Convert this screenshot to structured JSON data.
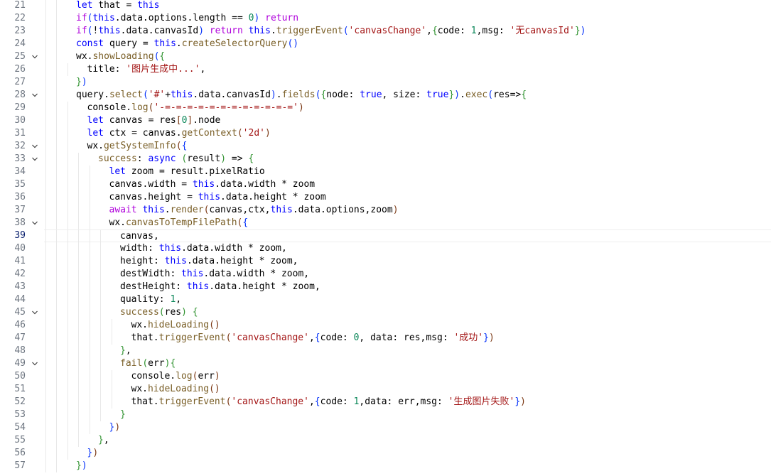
{
  "editor": {
    "current_line": 39,
    "lines": [
      {
        "n": "21",
        "i": 3,
        "t": [
          [
            "kw",
            "let"
          ],
          [
            "txt",
            " that = "
          ],
          [
            "this",
            "this"
          ]
        ]
      },
      {
        "n": "22",
        "i": 3,
        "t": [
          [
            "ctrl",
            "if"
          ],
          [
            "p1",
            "("
          ],
          [
            "this",
            "this"
          ],
          [
            "txt",
            ".data.options.length == "
          ],
          [
            "num",
            "0"
          ],
          [
            "p1",
            ")"
          ],
          [
            "txt",
            " "
          ],
          [
            "ctrl",
            "return"
          ]
        ]
      },
      {
        "n": "23",
        "i": 3,
        "t": [
          [
            "ctrl",
            "if"
          ],
          [
            "p1",
            "("
          ],
          [
            "txt",
            "!"
          ],
          [
            "this",
            "this"
          ],
          [
            "txt",
            ".data.canvasId"
          ],
          [
            "p1",
            ")"
          ],
          [
            "txt",
            " "
          ],
          [
            "ctrl",
            "return"
          ],
          [
            "txt",
            " "
          ],
          [
            "this",
            "this"
          ],
          [
            "txt",
            "."
          ],
          [
            "fn",
            "triggerEvent"
          ],
          [
            "p1",
            "("
          ],
          [
            "str",
            "'canvasChange'"
          ],
          [
            "txt",
            ","
          ],
          [
            "p2",
            "{"
          ],
          [
            "txt",
            "code: "
          ],
          [
            "num",
            "1"
          ],
          [
            "txt",
            ",msg: "
          ],
          [
            "str",
            "'无canvasId'"
          ],
          [
            "p2",
            "}"
          ],
          [
            "p1",
            ")"
          ]
        ]
      },
      {
        "n": "24",
        "i": 3,
        "t": [
          [
            "kw",
            "const"
          ],
          [
            "txt",
            " query = "
          ],
          [
            "this",
            "this"
          ],
          [
            "txt",
            "."
          ],
          [
            "fn",
            "createSelectorQuery"
          ],
          [
            "p1",
            "()"
          ]
        ]
      },
      {
        "n": "25",
        "i": 3,
        "fold": true,
        "t": [
          [
            "txt",
            "wx."
          ],
          [
            "fn",
            "showLoading"
          ],
          [
            "p1",
            "("
          ],
          [
            "p2",
            "{"
          ]
        ]
      },
      {
        "n": "26",
        "i": 4,
        "t": [
          [
            "txt",
            "title: "
          ],
          [
            "str",
            "'图片生成中...'"
          ],
          [
            "txt",
            ","
          ]
        ]
      },
      {
        "n": "27",
        "i": 3,
        "t": [
          [
            "p2",
            "}"
          ],
          [
            "p1",
            ")"
          ]
        ]
      },
      {
        "n": "28",
        "i": 3,
        "fold": true,
        "t": [
          [
            "txt",
            "query."
          ],
          [
            "fn",
            "select"
          ],
          [
            "p1",
            "("
          ],
          [
            "str",
            "'#'"
          ],
          [
            "txt",
            "+"
          ],
          [
            "this",
            "this"
          ],
          [
            "txt",
            ".data.canvasId"
          ],
          [
            "p1",
            ")"
          ],
          [
            "txt",
            "."
          ],
          [
            "fn",
            "fields"
          ],
          [
            "p1",
            "("
          ],
          [
            "p2",
            "{"
          ],
          [
            "txt",
            "node: "
          ],
          [
            "bool",
            "true"
          ],
          [
            "txt",
            ", size: "
          ],
          [
            "bool",
            "true"
          ],
          [
            "p2",
            "}"
          ],
          [
            "p1",
            ")"
          ],
          [
            "txt",
            "."
          ],
          [
            "fn",
            "exec"
          ],
          [
            "p1",
            "("
          ],
          [
            "txt",
            "res=>"
          ],
          [
            "p2",
            "{"
          ]
        ]
      },
      {
        "n": "29",
        "i": 4,
        "t": [
          [
            "txt",
            "console."
          ],
          [
            "fn",
            "log"
          ],
          [
            "p3",
            "("
          ],
          [
            "str",
            "'-=-=-=-=-=-=-=-=-=-=-=-='"
          ],
          [
            "p3",
            ")"
          ]
        ]
      },
      {
        "n": "30",
        "i": 4,
        "t": [
          [
            "kw",
            "let"
          ],
          [
            "txt",
            " canvas = res"
          ],
          [
            "p3",
            "["
          ],
          [
            "num",
            "0"
          ],
          [
            "p3",
            "]"
          ],
          [
            "txt",
            ".node"
          ]
        ]
      },
      {
        "n": "31",
        "i": 4,
        "t": [
          [
            "kw",
            "let"
          ],
          [
            "txt",
            " ctx = canvas."
          ],
          [
            "fn",
            "getContext"
          ],
          [
            "p3",
            "("
          ],
          [
            "str",
            "'2d'"
          ],
          [
            "p3",
            ")"
          ]
        ]
      },
      {
        "n": "32",
        "i": 4,
        "fold": true,
        "t": [
          [
            "txt",
            "wx."
          ],
          [
            "fn",
            "getSystemInfo"
          ],
          [
            "p3",
            "("
          ],
          [
            "p1",
            "{"
          ]
        ]
      },
      {
        "n": "33",
        "i": 5,
        "fold": true,
        "t": [
          [
            "fn",
            "success"
          ],
          [
            "txt",
            ": "
          ],
          [
            "kw",
            "async"
          ],
          [
            "txt",
            " "
          ],
          [
            "p2",
            "("
          ],
          [
            "txt",
            "result"
          ],
          [
            "p2",
            ")"
          ],
          [
            "txt",
            " => "
          ],
          [
            "p2",
            "{"
          ]
        ]
      },
      {
        "n": "34",
        "i": 6,
        "t": [
          [
            "kw",
            "let"
          ],
          [
            "txt",
            " zoom = result.pixelRatio"
          ]
        ]
      },
      {
        "n": "35",
        "i": 6,
        "t": [
          [
            "txt",
            "canvas.width = "
          ],
          [
            "this",
            "this"
          ],
          [
            "txt",
            ".data.width * zoom"
          ]
        ]
      },
      {
        "n": "36",
        "i": 6,
        "t": [
          [
            "txt",
            "canvas.height = "
          ],
          [
            "this",
            "this"
          ],
          [
            "txt",
            ".data.height * zoom"
          ]
        ]
      },
      {
        "n": "37",
        "i": 6,
        "t": [
          [
            "ctrl",
            "await"
          ],
          [
            "txt",
            " "
          ],
          [
            "this",
            "this"
          ],
          [
            "txt",
            "."
          ],
          [
            "fn",
            "render"
          ],
          [
            "p3",
            "("
          ],
          [
            "txt",
            "canvas,ctx,"
          ],
          [
            "this",
            "this"
          ],
          [
            "txt",
            ".data.options,zoom"
          ],
          [
            "p3",
            ")"
          ]
        ]
      },
      {
        "n": "38",
        "i": 6,
        "fold": true,
        "t": [
          [
            "txt",
            "wx."
          ],
          [
            "fn",
            "canvasToTempFilePath"
          ],
          [
            "p3",
            "("
          ],
          [
            "p1",
            "{"
          ]
        ]
      },
      {
        "n": "39",
        "i": 7,
        "t": [
          [
            "txt",
            "canvas,"
          ]
        ]
      },
      {
        "n": "40",
        "i": 7,
        "t": [
          [
            "txt",
            "width: "
          ],
          [
            "this",
            "this"
          ],
          [
            "txt",
            ".data.width * zoom,"
          ]
        ]
      },
      {
        "n": "41",
        "i": 7,
        "t": [
          [
            "txt",
            "height: "
          ],
          [
            "this",
            "this"
          ],
          [
            "txt",
            ".data.height * zoom,"
          ]
        ]
      },
      {
        "n": "42",
        "i": 7,
        "t": [
          [
            "txt",
            "destWidth: "
          ],
          [
            "this",
            "this"
          ],
          [
            "txt",
            ".data.width * zoom,"
          ]
        ]
      },
      {
        "n": "43",
        "i": 7,
        "t": [
          [
            "txt",
            "destHeight: "
          ],
          [
            "this",
            "this"
          ],
          [
            "txt",
            ".data.height * zoom,"
          ]
        ]
      },
      {
        "n": "44",
        "i": 7,
        "t": [
          [
            "txt",
            "quality: "
          ],
          [
            "num",
            "1"
          ],
          [
            "txt",
            ","
          ]
        ]
      },
      {
        "n": "45",
        "i": 7,
        "fold": true,
        "t": [
          [
            "fn",
            "success"
          ],
          [
            "p2",
            "("
          ],
          [
            "txt",
            "res"
          ],
          [
            "p2",
            ")"
          ],
          [
            "txt",
            " "
          ],
          [
            "p2",
            "{"
          ]
        ]
      },
      {
        "n": "46",
        "i": 8,
        "t": [
          [
            "txt",
            "wx."
          ],
          [
            "fn",
            "hideLoading"
          ],
          [
            "p3",
            "()"
          ]
        ]
      },
      {
        "n": "47",
        "i": 8,
        "t": [
          [
            "txt",
            "that."
          ],
          [
            "fn",
            "triggerEvent"
          ],
          [
            "p3",
            "("
          ],
          [
            "str",
            "'canvasChange'"
          ],
          [
            "txt",
            ","
          ],
          [
            "p1",
            "{"
          ],
          [
            "txt",
            "code: "
          ],
          [
            "num",
            "0"
          ],
          [
            "txt",
            ", data: res,msg: "
          ],
          [
            "str",
            "'成功'"
          ],
          [
            "p1",
            "}"
          ],
          [
            "p3",
            ")"
          ]
        ]
      },
      {
        "n": "48",
        "i": 7,
        "t": [
          [
            "p2",
            "}"
          ],
          [
            "txt",
            ","
          ]
        ]
      },
      {
        "n": "49",
        "i": 7,
        "fold": true,
        "t": [
          [
            "fn",
            "fail"
          ],
          [
            "p2",
            "("
          ],
          [
            "txt",
            "err"
          ],
          [
            "p2",
            ")"
          ],
          [
            "p2",
            "{"
          ]
        ]
      },
      {
        "n": "50",
        "i": 8,
        "t": [
          [
            "txt",
            "console."
          ],
          [
            "fn",
            "log"
          ],
          [
            "p3",
            "("
          ],
          [
            "txt",
            "err"
          ],
          [
            "p3",
            ")"
          ]
        ]
      },
      {
        "n": "51",
        "i": 8,
        "t": [
          [
            "txt",
            "wx."
          ],
          [
            "fn",
            "hideLoading"
          ],
          [
            "p3",
            "()"
          ]
        ]
      },
      {
        "n": "52",
        "i": 8,
        "t": [
          [
            "txt",
            "that."
          ],
          [
            "fn",
            "triggerEvent"
          ],
          [
            "p3",
            "("
          ],
          [
            "str",
            "'canvasChange'"
          ],
          [
            "txt",
            ","
          ],
          [
            "p1",
            "{"
          ],
          [
            "txt",
            "code: "
          ],
          [
            "num",
            "1"
          ],
          [
            "txt",
            ",data: err,msg: "
          ],
          [
            "str",
            "'生成图片失败'"
          ],
          [
            "p1",
            "}"
          ],
          [
            "p3",
            ")"
          ]
        ]
      },
      {
        "n": "53",
        "i": 7,
        "t": [
          [
            "p2",
            "}"
          ]
        ]
      },
      {
        "n": "54",
        "i": 6,
        "t": [
          [
            "p1",
            "}"
          ],
          [
            "p3",
            ")"
          ]
        ]
      },
      {
        "n": "55",
        "i": 5,
        "t": [
          [
            "p2",
            "}"
          ],
          [
            "txt",
            ","
          ]
        ]
      },
      {
        "n": "56",
        "i": 4,
        "t": [
          [
            "p1",
            "}"
          ],
          [
            "p3",
            ")"
          ]
        ]
      },
      {
        "n": "57",
        "i": 3,
        "t": [
          [
            "p2",
            "}"
          ],
          [
            "p1",
            ")"
          ]
        ]
      }
    ]
  },
  "icons": {
    "fold": "chevron-down-icon"
  },
  "colors": {
    "background": "#ffffff",
    "line_number": "#6e7681",
    "keyword": "#0000ff",
    "control": "#af00db",
    "function": "#795e26",
    "string": "#a31515",
    "number": "#098658"
  }
}
